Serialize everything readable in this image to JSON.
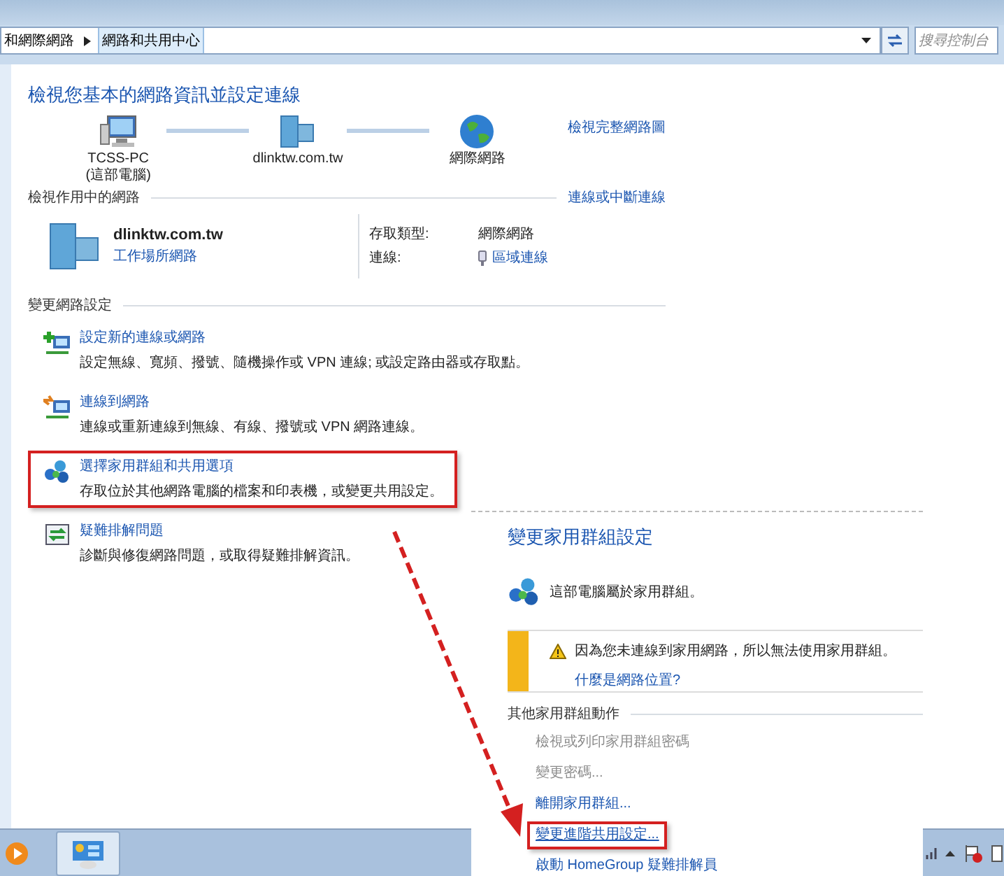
{
  "address_bar": {
    "breadcrumbs": [
      {
        "label": "和網際網路",
        "selected": false
      },
      {
        "label": "網路和共用中心",
        "selected": true
      }
    ],
    "search_placeholder": "搜尋控制台"
  },
  "main": {
    "title": "檢視您基本的網路資訊並設定連線",
    "map_link": "檢視完整網路圖",
    "map_nodes": [
      {
        "kind": "computer",
        "label": "TCSS-PC",
        "sublabel": "(這部電腦)"
      },
      {
        "kind": "domain",
        "label": "dlinktw.com.tw"
      },
      {
        "kind": "internet",
        "label": "網際網路"
      }
    ],
    "active_networks": {
      "heading": "檢視作用中的網路",
      "link": "連線或中斷連線",
      "name": "dlinktw.com.tw",
      "type_link": "工作場所網路",
      "access_label": "存取類型:",
      "access_value": "網際網路",
      "connection_label": "連線:",
      "connection_value": "區域連線"
    },
    "change_settings": {
      "heading": "變更網路設定",
      "tasks": [
        {
          "kind": "new-connection",
          "title": "設定新的連線或網路",
          "description": "設定無線、寬頻、撥號、隨機操作或 VPN 連線; 或設定路由器或存取點。",
          "highlighted": false
        },
        {
          "kind": "connect",
          "title": "連線到網路",
          "description": "連線或重新連線到無線、有線、撥號或 VPN 網路連線。",
          "highlighted": false
        },
        {
          "kind": "homegroup",
          "title": "選擇家用群組和共用選項",
          "description": "存取位於其他網路電腦的檔案和印表機，或變更共用設定。",
          "highlighted": true
        },
        {
          "kind": "troubleshoot",
          "title": "疑難排解問題",
          "description": "診斷與修復網路問題，或取得疑難排解資訊。",
          "highlighted": false
        }
      ]
    }
  },
  "homegroup_panel": {
    "title": "變更家用群組設定",
    "status": "這部電腦屬於家用群組。",
    "warning": {
      "text": "因為您未連線到家用網路，所以無法使用家用群組。",
      "link": "什麼是網路位置?"
    },
    "other_actions": {
      "heading": "其他家用群組動作",
      "links": [
        {
          "label": "檢視或列印家用群組密碼",
          "disabled": true,
          "highlighted": false
        },
        {
          "label": "變更密碼...",
          "disabled": true,
          "highlighted": false
        },
        {
          "label": "離開家用群組...",
          "disabled": false,
          "highlighted": false
        },
        {
          "label": "變更進階共用設定...",
          "disabled": false,
          "highlighted": true
        },
        {
          "label": "啟動 HomeGroup 疑難排解員",
          "disabled": false,
          "highlighted": false
        }
      ]
    }
  },
  "taskbar": {
    "buttons": [
      {
        "kind": "media-player",
        "selected": false
      },
      {
        "kind": "control-panel",
        "selected": true
      }
    ]
  }
}
